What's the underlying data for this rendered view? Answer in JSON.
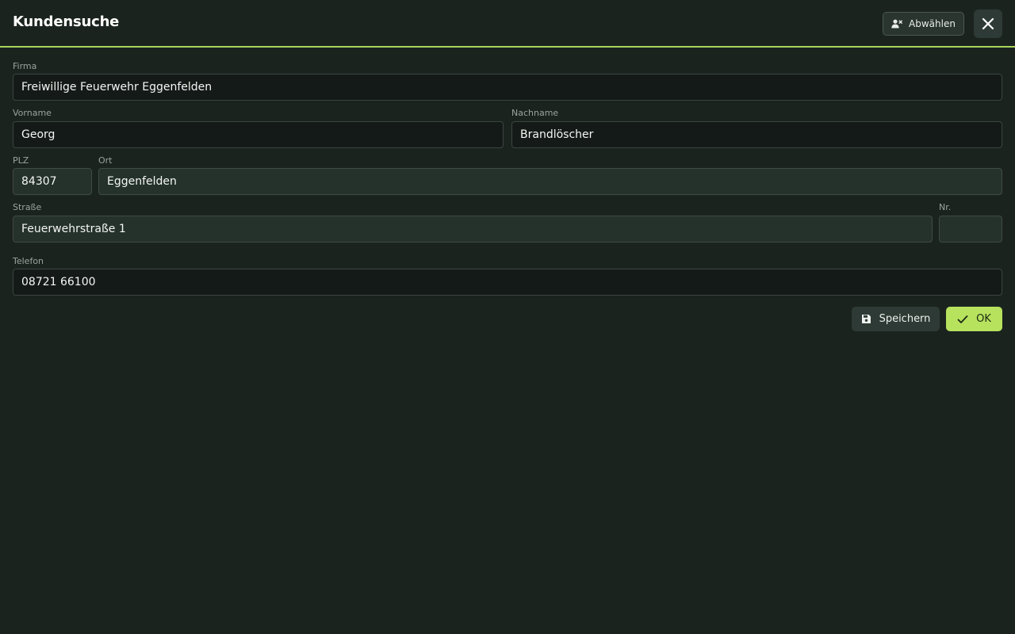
{
  "header": {
    "title": "Kundensuche",
    "deselect_label": "Abwählen",
    "deselect_icon": "user-remove-icon",
    "close_icon": "close-icon"
  },
  "form": {
    "firma": {
      "label": "Firma",
      "value": "Freiwillige Feuerwehr Eggenfelden"
    },
    "vorname": {
      "label": "Vorname",
      "value": "Georg"
    },
    "nachname": {
      "label": "Nachname",
      "value": "Brandlöscher"
    },
    "plz": {
      "label": "PLZ",
      "value": "84307"
    },
    "ort": {
      "label": "Ort",
      "value": "Eggenfelden"
    },
    "strasse": {
      "label": "Straße",
      "value": "Feuerwehrstraße 1"
    },
    "nr": {
      "label": "Nr.",
      "value": ""
    },
    "telefon": {
      "label": "Telefon",
      "value": "08721 66100"
    }
  },
  "actions": {
    "save_label": "Speichern",
    "save_icon": "floppy-disk-icon",
    "ok_label": "OK",
    "ok_icon": "check-icon"
  },
  "colors": {
    "background": "#1b231f",
    "accent": "#b7e25e",
    "header_border": "#a6d65a",
    "autofilled_field": "#25322c"
  }
}
